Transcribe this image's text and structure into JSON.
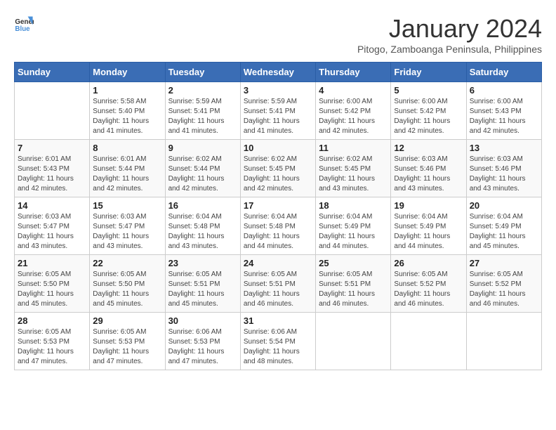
{
  "logo": {
    "text_general": "General",
    "text_blue": "Blue"
  },
  "title": "January 2024",
  "subtitle": "Pitogo, Zamboanga Peninsula, Philippines",
  "headers": [
    "Sunday",
    "Monday",
    "Tuesday",
    "Wednesday",
    "Thursday",
    "Friday",
    "Saturday"
  ],
  "weeks": [
    [
      {
        "day": "",
        "info": ""
      },
      {
        "day": "1",
        "info": "Sunrise: 5:58 AM\nSunset: 5:40 PM\nDaylight: 11 hours and 41 minutes."
      },
      {
        "day": "2",
        "info": "Sunrise: 5:59 AM\nSunset: 5:41 PM\nDaylight: 11 hours and 41 minutes."
      },
      {
        "day": "3",
        "info": "Sunrise: 5:59 AM\nSunset: 5:41 PM\nDaylight: 11 hours and 41 minutes."
      },
      {
        "day": "4",
        "info": "Sunrise: 6:00 AM\nSunset: 5:42 PM\nDaylight: 11 hours and 42 minutes."
      },
      {
        "day": "5",
        "info": "Sunrise: 6:00 AM\nSunset: 5:42 PM\nDaylight: 11 hours and 42 minutes."
      },
      {
        "day": "6",
        "info": "Sunrise: 6:00 AM\nSunset: 5:43 PM\nDaylight: 11 hours and 42 minutes."
      }
    ],
    [
      {
        "day": "7",
        "info": "Sunrise: 6:01 AM\nSunset: 5:43 PM\nDaylight: 11 hours and 42 minutes."
      },
      {
        "day": "8",
        "info": "Sunrise: 6:01 AM\nSunset: 5:44 PM\nDaylight: 11 hours and 42 minutes."
      },
      {
        "day": "9",
        "info": "Sunrise: 6:02 AM\nSunset: 5:44 PM\nDaylight: 11 hours and 42 minutes."
      },
      {
        "day": "10",
        "info": "Sunrise: 6:02 AM\nSunset: 5:45 PM\nDaylight: 11 hours and 42 minutes."
      },
      {
        "day": "11",
        "info": "Sunrise: 6:02 AM\nSunset: 5:45 PM\nDaylight: 11 hours and 43 minutes."
      },
      {
        "day": "12",
        "info": "Sunrise: 6:03 AM\nSunset: 5:46 PM\nDaylight: 11 hours and 43 minutes."
      },
      {
        "day": "13",
        "info": "Sunrise: 6:03 AM\nSunset: 5:46 PM\nDaylight: 11 hours and 43 minutes."
      }
    ],
    [
      {
        "day": "14",
        "info": "Sunrise: 6:03 AM\nSunset: 5:47 PM\nDaylight: 11 hours and 43 minutes."
      },
      {
        "day": "15",
        "info": "Sunrise: 6:03 AM\nSunset: 5:47 PM\nDaylight: 11 hours and 43 minutes."
      },
      {
        "day": "16",
        "info": "Sunrise: 6:04 AM\nSunset: 5:48 PM\nDaylight: 11 hours and 43 minutes."
      },
      {
        "day": "17",
        "info": "Sunrise: 6:04 AM\nSunset: 5:48 PM\nDaylight: 11 hours and 44 minutes."
      },
      {
        "day": "18",
        "info": "Sunrise: 6:04 AM\nSunset: 5:49 PM\nDaylight: 11 hours and 44 minutes."
      },
      {
        "day": "19",
        "info": "Sunrise: 6:04 AM\nSunset: 5:49 PM\nDaylight: 11 hours and 44 minutes."
      },
      {
        "day": "20",
        "info": "Sunrise: 6:04 AM\nSunset: 5:49 PM\nDaylight: 11 hours and 45 minutes."
      }
    ],
    [
      {
        "day": "21",
        "info": "Sunrise: 6:05 AM\nSunset: 5:50 PM\nDaylight: 11 hours and 45 minutes."
      },
      {
        "day": "22",
        "info": "Sunrise: 6:05 AM\nSunset: 5:50 PM\nDaylight: 11 hours and 45 minutes."
      },
      {
        "day": "23",
        "info": "Sunrise: 6:05 AM\nSunset: 5:51 PM\nDaylight: 11 hours and 45 minutes."
      },
      {
        "day": "24",
        "info": "Sunrise: 6:05 AM\nSunset: 5:51 PM\nDaylight: 11 hours and 46 minutes."
      },
      {
        "day": "25",
        "info": "Sunrise: 6:05 AM\nSunset: 5:51 PM\nDaylight: 11 hours and 46 minutes."
      },
      {
        "day": "26",
        "info": "Sunrise: 6:05 AM\nSunset: 5:52 PM\nDaylight: 11 hours and 46 minutes."
      },
      {
        "day": "27",
        "info": "Sunrise: 6:05 AM\nSunset: 5:52 PM\nDaylight: 11 hours and 46 minutes."
      }
    ],
    [
      {
        "day": "28",
        "info": "Sunrise: 6:05 AM\nSunset: 5:53 PM\nDaylight: 11 hours and 47 minutes."
      },
      {
        "day": "29",
        "info": "Sunrise: 6:05 AM\nSunset: 5:53 PM\nDaylight: 11 hours and 47 minutes."
      },
      {
        "day": "30",
        "info": "Sunrise: 6:06 AM\nSunset: 5:53 PM\nDaylight: 11 hours and 47 minutes."
      },
      {
        "day": "31",
        "info": "Sunrise: 6:06 AM\nSunset: 5:54 PM\nDaylight: 11 hours and 48 minutes."
      },
      {
        "day": "",
        "info": ""
      },
      {
        "day": "",
        "info": ""
      },
      {
        "day": "",
        "info": ""
      }
    ]
  ]
}
